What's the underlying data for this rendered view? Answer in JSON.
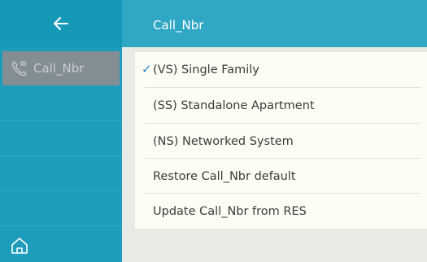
{
  "sidebar": {
    "back_icon": "arrow-left-icon",
    "item": {
      "label": "Call_Nbr",
      "icon": "call-icon"
    },
    "home_icon": "home-icon"
  },
  "header": {
    "title": "Call_Nbr"
  },
  "menu": {
    "items": [
      {
        "label": "(VS) Single Family",
        "selected": true
      },
      {
        "label": "(SS) Standalone Apartment",
        "selected": false
      },
      {
        "label": "(NS) Networked System",
        "selected": false
      },
      {
        "label": "Restore Call_Nbr default",
        "selected": false
      },
      {
        "label": "Update Call_Nbr from RES",
        "selected": false
      }
    ],
    "check_mark": "✓"
  },
  "colors": {
    "sidebar": "#1d9cbc",
    "header": "#30a7c4",
    "selected_item": "#828d94",
    "menu_bg": "#fdfdf3",
    "check": "#2b86cc"
  }
}
